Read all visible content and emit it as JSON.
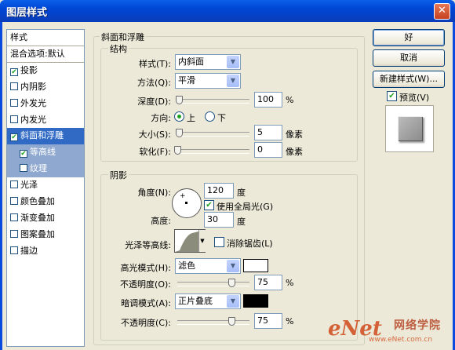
{
  "window": {
    "title": "图层样式",
    "close": "✕"
  },
  "sidebar": {
    "items": [
      {
        "label": "样式",
        "type": "header"
      },
      {
        "label": "混合选项:默认",
        "type": "header"
      },
      {
        "label": "投影",
        "checked": true
      },
      {
        "label": "内阴影",
        "checked": false
      },
      {
        "label": "外发光",
        "checked": false
      },
      {
        "label": "内发光",
        "checked": false
      },
      {
        "label": "斜面和浮雕",
        "checked": true,
        "selected": true
      },
      {
        "label": "等高线",
        "checked": true,
        "sub": true
      },
      {
        "label": "纹理",
        "checked": false,
        "sub": true
      },
      {
        "label": "光泽",
        "checked": false
      },
      {
        "label": "颜色叠加",
        "checked": false
      },
      {
        "label": "渐变叠加",
        "checked": false
      },
      {
        "label": "图案叠加",
        "checked": false
      },
      {
        "label": "描边",
        "checked": false
      }
    ],
    "check_glyph": "✔"
  },
  "bevel": {
    "title": "斜面和浮雕",
    "structure": {
      "title": "结构",
      "style_label": "样式(T):",
      "style_value": "内斜面",
      "technique_label": "方法(Q):",
      "technique_value": "平滑",
      "depth_label": "深度(D):",
      "depth_value": "100",
      "depth_unit": "%",
      "depth_level": 0.02,
      "direction_label": "方向:",
      "direction_up": "上",
      "direction_down": "下",
      "direction_selected": "上",
      "size_label": "大小(S):",
      "size_value": "5",
      "size_unit": "像素",
      "size_level": 0.02,
      "soften_label": "软化(F):",
      "soften_value": "0",
      "soften_unit": "像素",
      "soften_level": 0.0
    },
    "shading": {
      "title": "阴影",
      "angle_label": "角度(N):",
      "angle_value": "120",
      "angle_unit": "度",
      "global_light_label": "使用全局光(G)",
      "global_light_checked": true,
      "altitude_label": "高度:",
      "altitude_value": "30",
      "altitude_unit": "度",
      "gloss_contour_label": "光泽等高线:",
      "anti_alias_label": "消除锯齿(L)",
      "anti_alias_checked": false,
      "highlight_mode_label": "高光模式(H):",
      "highlight_mode_value": "滤色",
      "highlight_color": "#ffffff",
      "highlight_opacity_label": "不透明度(O):",
      "highlight_opacity_value": "75",
      "highlight_opacity_unit": "%",
      "highlight_opacity_level": 0.75,
      "shadow_mode_label": "暗调模式(A):",
      "shadow_mode_value": "正片叠底",
      "shadow_color": "#000000",
      "shadow_opacity_label": "不透明度(C):",
      "shadow_opacity_value": "75",
      "shadow_opacity_unit": "%",
      "shadow_opacity_level": 0.75
    }
  },
  "buttons": {
    "ok": "好",
    "cancel": "取消",
    "new_style": "新建样式(W)...",
    "preview": "预览(V)",
    "preview_checked": true
  },
  "watermark": {
    "brand": "eNet",
    "text": "网络学院",
    "url": "www.eNet.com.cn"
  }
}
